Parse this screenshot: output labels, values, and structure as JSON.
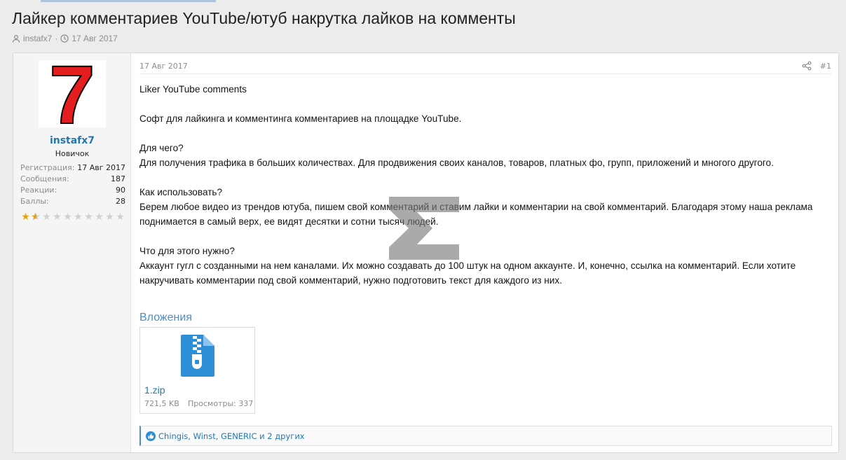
{
  "thread": {
    "title": "Лайкер комментариев YouTube/ютуб накрутка лайков на комменты",
    "author": "instafx7",
    "date": "17 Авг 2017"
  },
  "user": {
    "name": "instafx7",
    "rank": "Новичок",
    "avatar_text": "7",
    "stats": [
      {
        "label": "Регистрация:",
        "value": "17 Авг 2017"
      },
      {
        "label": "Сообщения:",
        "value": "187"
      },
      {
        "label": "Реакции:",
        "value": "90"
      },
      {
        "label": "Баллы:",
        "value": "28"
      }
    ],
    "rating": 1.5,
    "rating_max": 10
  },
  "post": {
    "date": "17 Авг 2017",
    "number": "#1",
    "paragraphs": [
      [
        "Liker YouTube comments"
      ],
      [
        "Софт для лайкинга и комментинга комментариев на площадке YouTube."
      ],
      [
        "Для чего?",
        "Для получения трафика в больших количествах. Для продвижения своих каналов, товаров, платных фо, групп, приложений и многого другого."
      ],
      [
        "Как использовать?",
        "Берем любое видео из трендов ютуба, пишем свой комментарий и ставим лайки и комментарии на свой комментарий. Благодаря этому наша реклама поднимается в самый верх, ее видят десятки и сотни тысяч людей."
      ],
      [
        "Что для этого нужно?",
        "Аккаунт гугл с созданными на нем каналами. Их можно создавать до 100 штук на одном аккаунте. И, конечно, ссылка на комментарий. Если хотите накручивать комментарии под свой комментарий, нужно подготовить текст для каждого из них."
      ]
    ]
  },
  "attachments": {
    "heading": "Вложения",
    "file": {
      "name": "1.zip",
      "size": "721,5 KB",
      "views": "Просмотры: 337"
    }
  },
  "reactions": {
    "text": "Chingis, Winst, GENERIC и 2 других"
  },
  "colors": {
    "accent": "#2577b1",
    "avatar_red": "#e41e1e",
    "star": "#e2a413"
  }
}
